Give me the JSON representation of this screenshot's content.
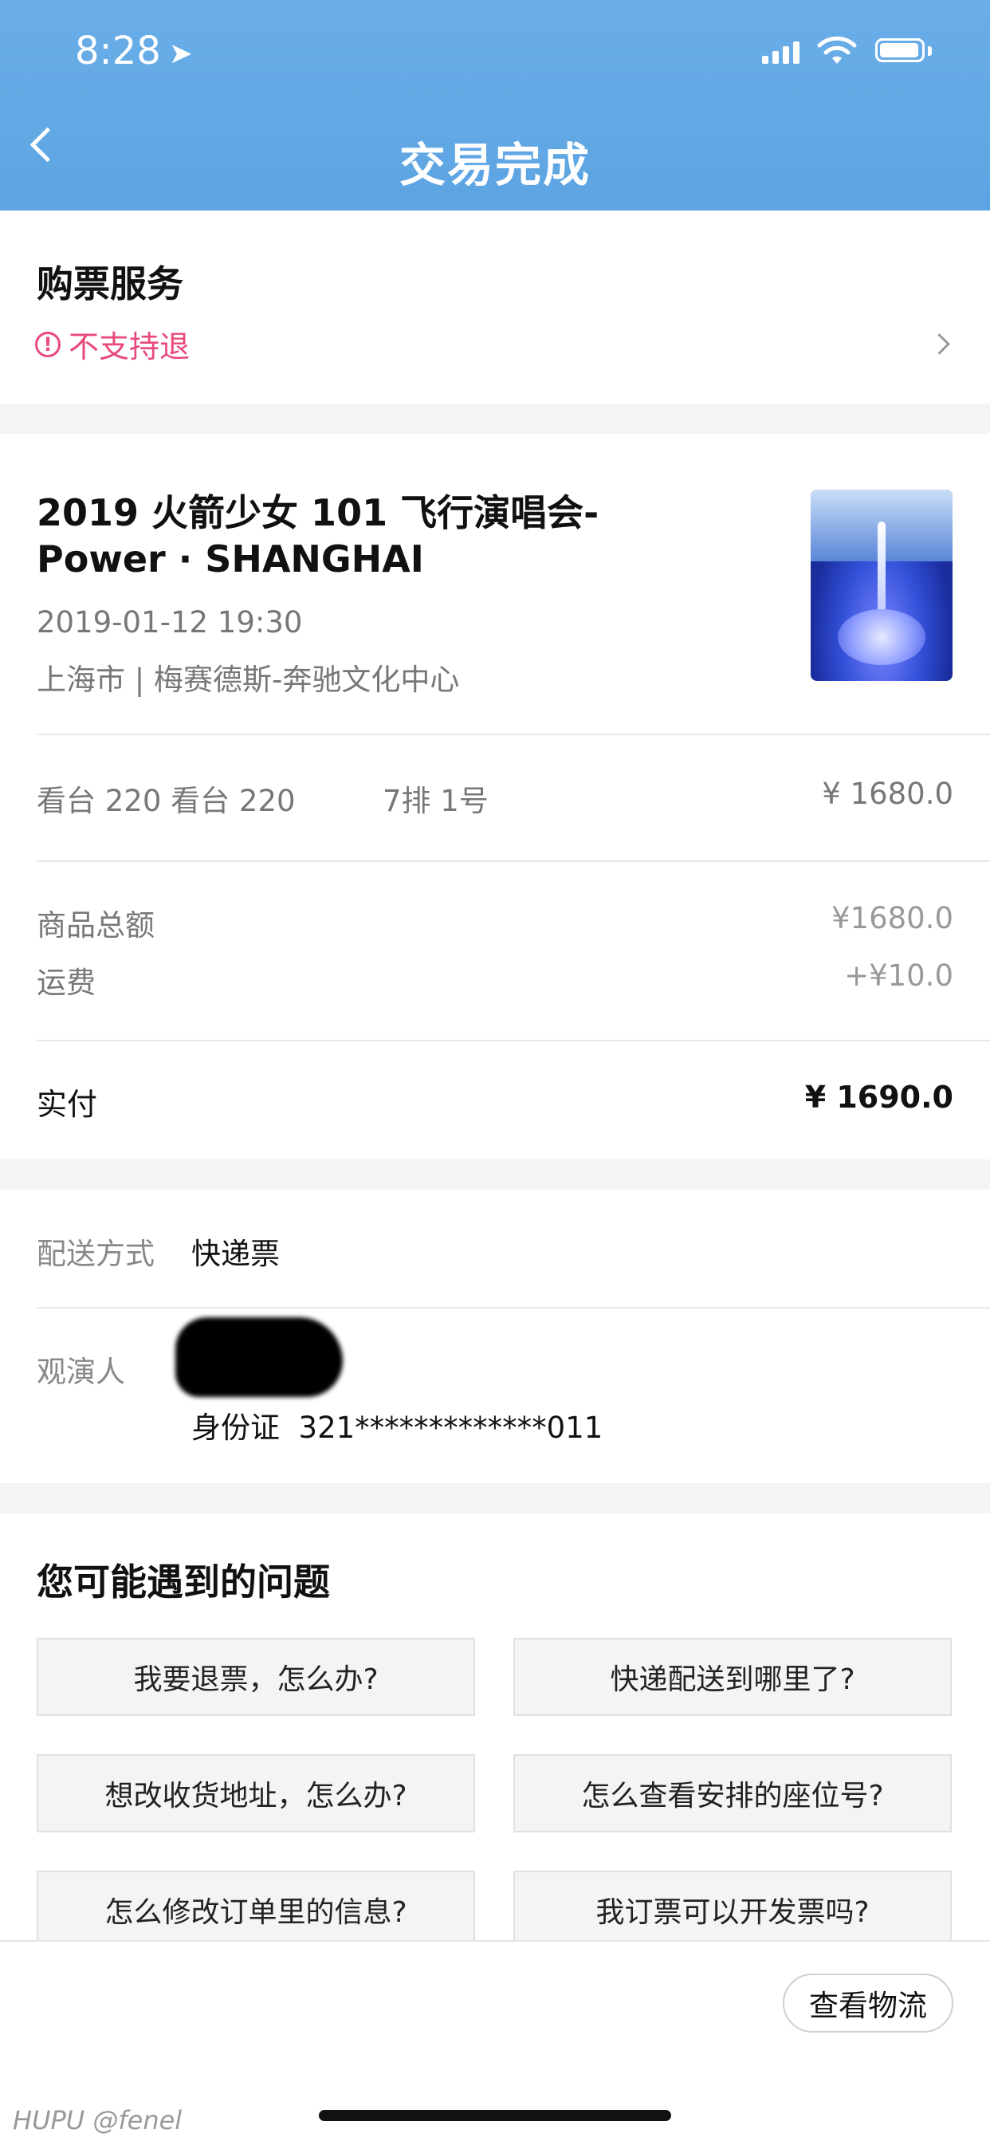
{
  "status_bar": {
    "time": "8:28"
  },
  "header": {
    "title": "交易完成"
  },
  "service": {
    "title": "购票服务",
    "refund_note": "不支持退"
  },
  "event": {
    "name": "2019 火箭少女 101 飞行演唱会-Power · SHANGHAI",
    "datetime": "2019-01-12 19:30",
    "venue": "上海市 | 梅赛德斯-奔驰文化中心"
  },
  "ticket": {
    "area": "看台 220 看台 220",
    "seat": "7排 1号",
    "price": "¥ 1680.0"
  },
  "totals": {
    "goods_label": "商品总额",
    "goods_value": "¥1680.0",
    "shipping_label": "运费",
    "shipping_value": "+¥10.0",
    "paid_label": "实付",
    "paid_value": "¥ 1690.0"
  },
  "delivery": {
    "method_label": "配送方式",
    "method_value": "快递票",
    "viewer_label": "观演人",
    "id_label": "身份证",
    "id_value": "321*************011"
  },
  "faq": {
    "title": "您可能遇到的问题",
    "items": [
      "我要退票，怎么办?",
      "快递配送到哪里了?",
      "想改收货地址，怎么办?",
      "怎么查看安排的座位号?",
      "怎么修改订单里的信息?",
      "我订票可以开发票吗?"
    ]
  },
  "bottom": {
    "logistics_button": "查看物流"
  },
  "watermark": "HUPU @fenel"
}
